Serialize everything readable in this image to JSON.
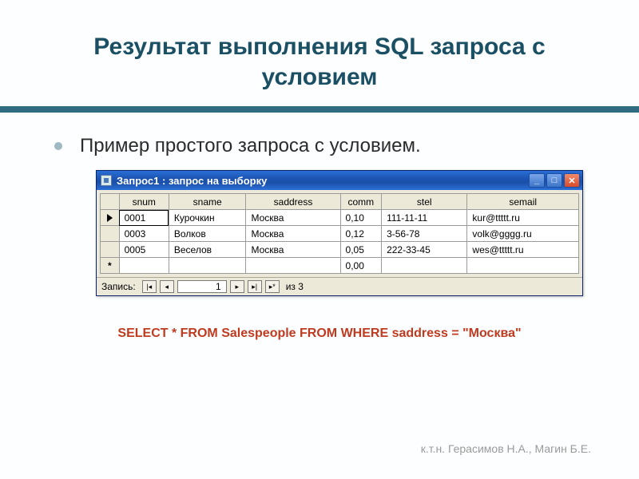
{
  "title": "Результат выполнения SQL запроса с условием",
  "bullet": "Пример простого запроса с условием.",
  "window": {
    "title": "Запрос1 : запрос на выборку",
    "columns": [
      "snum",
      "sname",
      "saddress",
      "comm",
      "stel",
      "semail"
    ],
    "rows": [
      {
        "indicator": "current",
        "snum": "0001",
        "sname": "Курочкин",
        "saddress": "Москва",
        "comm": "0,10",
        "stel": "111-11-11",
        "semail": "kur@ttttt.ru"
      },
      {
        "indicator": "",
        "snum": "0003",
        "sname": "Волков",
        "saddress": "Москва",
        "comm": "0,12",
        "stel": "3-56-78",
        "semail": "volk@gggg.ru"
      },
      {
        "indicator": "",
        "snum": "0005",
        "sname": "Веселов",
        "saddress": "Москва",
        "comm": "0,05",
        "stel": "222-33-45",
        "semail": "wes@ttttt.ru"
      },
      {
        "indicator": "new",
        "snum": "",
        "sname": "",
        "saddress": "",
        "comm": "0,00",
        "stel": "",
        "semail": ""
      }
    ],
    "nav": {
      "label": "Запись:",
      "pos": "1",
      "total": "из  3"
    }
  },
  "sql": "SELECT * FROM Salespeople FROM WHERE saddress = \"Москва\"",
  "footer": "к.т.н. Герасимов Н.А., Магин Б.Е."
}
